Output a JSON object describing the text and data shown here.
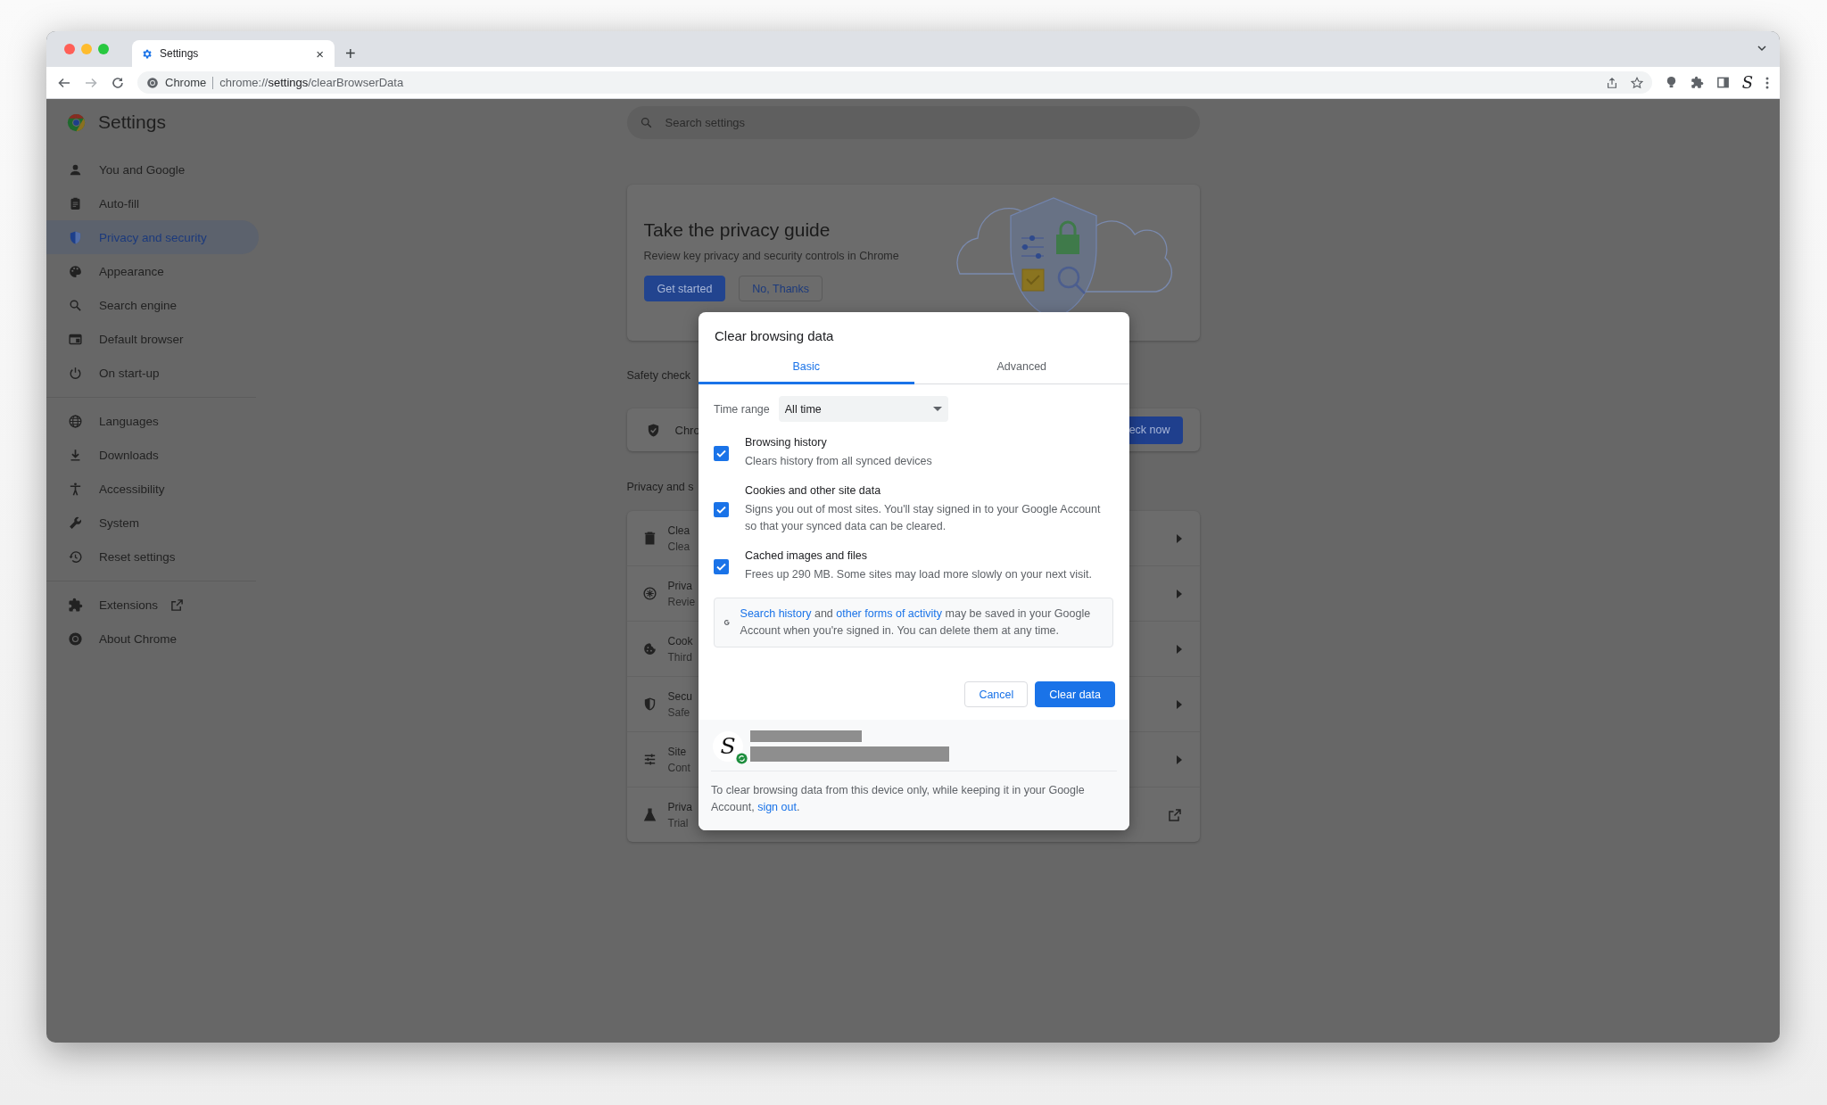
{
  "browser": {
    "tab": {
      "title": "Settings",
      "close": "×"
    },
    "new_tab": "+",
    "omnibox": {
      "chip": "Chrome",
      "url": "chrome://**settings**/clearBrowserData"
    },
    "profile_letter": "S"
  },
  "sidebar": {
    "title": "Settings",
    "groups": [
      [
        {
          "label": "You and Google",
          "selected": false,
          "kind": "page"
        },
        {
          "label": "Auto-fill",
          "selected": false,
          "kind": "page"
        },
        {
          "label": "Privacy and security",
          "selected": true,
          "kind": "page"
        },
        {
          "label": "Appearance",
          "selected": false,
          "kind": "page"
        },
        {
          "label": "Search engine",
          "selected": false,
          "kind": "page"
        },
        {
          "label": "Default browser",
          "selected": false,
          "kind": "page"
        },
        {
          "label": "On start-up",
          "selected": false,
          "kind": "page"
        }
      ],
      [
        {
          "label": "Languages",
          "selected": false,
          "kind": "page"
        },
        {
          "label": "Downloads",
          "selected": false,
          "kind": "page"
        },
        {
          "label": "Accessibility",
          "selected": false,
          "kind": "page"
        },
        {
          "label": "System",
          "selected": false,
          "kind": "page"
        },
        {
          "label": "Reset settings",
          "selected": false,
          "kind": "page"
        }
      ],
      [
        {
          "label": "Extensions",
          "selected": false,
          "kind": "external"
        },
        {
          "label": "About Chrome",
          "selected": false,
          "kind": "page"
        }
      ]
    ]
  },
  "search": {
    "placeholder": "Search settings"
  },
  "privacy_guide": {
    "title": "Take the privacy guide",
    "description": "Review key privacy and security controls in Chrome",
    "buttons": [
      {
        "label": "Get started",
        "kind": "primary"
      },
      {
        "label": "No, Thanks",
        "kind": "secondary"
      }
    ]
  },
  "safety_check": {
    "heading": "Safety check",
    "row_text": "Chro",
    "button": "eck now"
  },
  "privacy_section": {
    "heading": "Privacy and s",
    "rows": [
      {
        "title": "Clea",
        "subtitle": "Clea",
        "kind": "arrow"
      },
      {
        "title": "Priva",
        "subtitle": "Revie",
        "kind": "arrow"
      },
      {
        "title": "Cook",
        "subtitle": "Third",
        "kind": "arrow"
      },
      {
        "title": "Secu",
        "subtitle": "Safe",
        "kind": "arrow"
      },
      {
        "title": "Site",
        "subtitle": "Cont",
        "kind": "arrow"
      },
      {
        "title": "Priva",
        "subtitle": "Trial",
        "kind": "external"
      }
    ]
  },
  "dialog": {
    "title": "Clear browsing data",
    "tabs": [
      {
        "label": "Basic",
        "selected": true
      },
      {
        "label": "Advanced",
        "selected": false
      }
    ],
    "time_range": {
      "label": "Time range",
      "value": "All time"
    },
    "options": [
      {
        "title": "Browsing history",
        "description": "Clears history from all synced devices",
        "checked": true
      },
      {
        "title": "Cookies and other site data",
        "description": "Signs you out of most sites. You'll stay signed in to your Google Account so that your synced data can be cleared.",
        "checked": true
      },
      {
        "title": "Cached images and files",
        "description": "Frees up 290 MB. Some sites may load more slowly on your next visit.",
        "checked": true
      }
    ],
    "info": [
      {
        "kind": "link",
        "text": "Search history"
      },
      {
        "kind": "text",
        "text": " and "
      },
      {
        "kind": "link",
        "text": "other forms of activity"
      },
      {
        "kind": "text",
        "text": " may be saved in your Google Account when you're signed in. You can delete them at any time."
      }
    ],
    "buttons": [
      {
        "label": "Cancel",
        "kind": "secondary"
      },
      {
        "label": "Clear data",
        "kind": "primary"
      }
    ],
    "account": {
      "avatar_letter": "S"
    },
    "footer": [
      {
        "kind": "text",
        "text": "To clear browsing data from this device only, while keeping it in your Google Account, "
      },
      {
        "kind": "link",
        "text": "sign out"
      },
      {
        "kind": "text",
        "text": "."
      }
    ]
  }
}
